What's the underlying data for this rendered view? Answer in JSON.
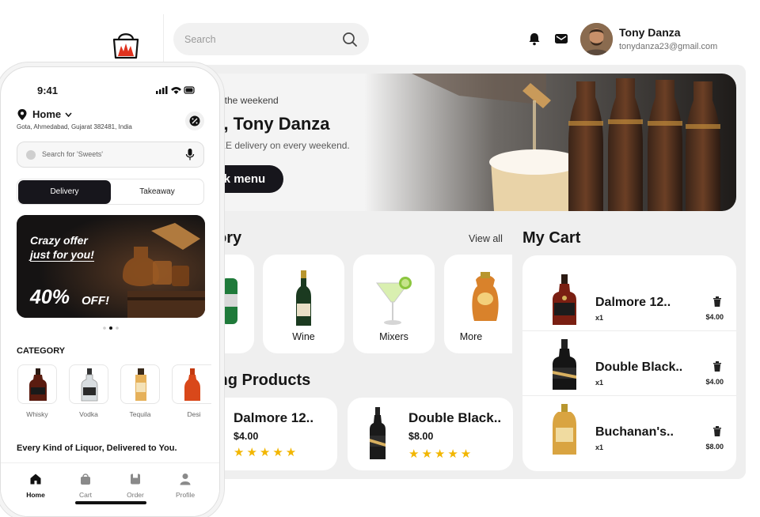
{
  "header": {
    "search_placeholder": "Search",
    "user_name": "Tony Danza",
    "user_email": "tonydanza23@gmail.com"
  },
  "hero": {
    "subtitle": "f the weekend",
    "title": "o, Tony Danza",
    "description": "EE delivery on every weekend.",
    "button_label": "eck menu"
  },
  "category": {
    "title": "ory",
    "view_all": "View all",
    "items": [
      {
        "label": "r",
        "icon": "beer-bottle-icon"
      },
      {
        "label": "Wine",
        "icon": "wine-bottle-icon"
      },
      {
        "label": "Mixers",
        "icon": "cocktail-icon"
      },
      {
        "label": "More",
        "icon": "liquor-bottle-icon"
      }
    ]
  },
  "trending": {
    "title": "ing Products",
    "items": [
      {
        "name": "Dalmore 12..",
        "price": "$4.00",
        "stars": "★★★★★"
      },
      {
        "name": "Double Black..",
        "price": "$8.00",
        "stars": "★★★★★"
      }
    ]
  },
  "cart": {
    "title": "My Cart",
    "items": [
      {
        "name": "Dalmore 12..",
        "qty": "x1",
        "price": "$4.00"
      },
      {
        "name": "Double Black..",
        "qty": "x1",
        "price": "$4.00"
      },
      {
        "name": "Buchanan's..",
        "qty": "x1",
        "price": "$8.00"
      }
    ]
  },
  "phone": {
    "time": "9:41",
    "location_title": "Home",
    "location_address": "Gota, Ahmedabad, Gujarat 382481, India",
    "search_placeholder": "Search for 'Sweets'",
    "toggle": {
      "active": "Delivery",
      "inactive": "Takeaway"
    },
    "banner": {
      "line1": "Crazy offer",
      "line2": "just for you!",
      "percent": "40%",
      "off": "OFF!"
    },
    "category_heading": "CATEGORY",
    "categories": [
      "Whisky",
      "Vodka",
      "Tequila",
      "Desi"
    ],
    "tagline": "Every Kind of Liquor, Delivered to You.",
    "nav": [
      "Home",
      "Cart",
      "Order",
      "Profile"
    ]
  },
  "colors": {
    "accent_dark": "#17161c",
    "star": "#f2b600",
    "logo_red": "#e0321e"
  }
}
